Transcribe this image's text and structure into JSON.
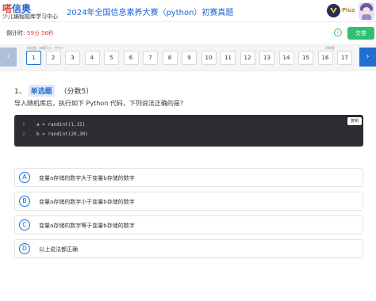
{
  "header": {
    "logo_main_a": "嗒",
    "logo_main_b": "信奥",
    "logo_sub": "少儿编程题库学习中心",
    "title": "2024年全国信息素养大赛（python）初赛真题",
    "plus_label": "Plus",
    "plus_icon": "plus-membership-icon"
  },
  "timer": {
    "label": "倒计时:",
    "value": "59分 56秒",
    "info_icon": "info-icon",
    "submit_label": "交卷"
  },
  "question_nav": {
    "prev_icon": "chevron-left-icon",
    "next_icon": "chevron-right-icon",
    "group_labels": [
      "单选题（每题5分，共?分）",
      "判断题"
    ],
    "numbers": [
      "1",
      "2",
      "3",
      "4",
      "5",
      "6",
      "7",
      "8",
      "9",
      "10",
      "11",
      "12",
      "13",
      "14",
      "15",
      "16",
      "17"
    ],
    "active_index": 0
  },
  "question": {
    "number": "1、",
    "type": "单选题",
    "score": "（分数5）",
    "text": "导入随机库后，执行如下 Python 代码，下列说法正确的是?",
    "code_lines": [
      {
        "ln": "1",
        "code": "a = randint(1,15)"
      },
      {
        "ln": "2",
        "code": "b = randint(20,30)"
      }
    ],
    "copy_label": "复制"
  },
  "options": [
    {
      "letter": "A",
      "text": "变量a存储的数字大于变量b存储的数字"
    },
    {
      "letter": "B",
      "text": "变量a存储的数字小于变量b存储的数字"
    },
    {
      "letter": "C",
      "text": "变量a存储的数字等于变量b存储的数字"
    },
    {
      "letter": "D",
      "text": "以上说法都正确"
    }
  ],
  "colors": {
    "accent": "#1f6fd1",
    "submit": "#2fbf71",
    "timer": "#e03a3a",
    "code_bg": "#2b2d30"
  }
}
